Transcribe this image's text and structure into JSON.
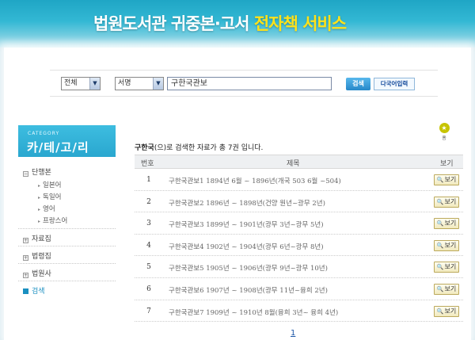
{
  "header": {
    "title_main": "법원도서관 귀중본·고서",
    "title_accent": "전자책 서비스"
  },
  "search": {
    "scope_value": "전체",
    "field_value": "서명",
    "query_value": "구한국관보",
    "search_button": "검색",
    "multi_lang_button": "다국어입력"
  },
  "sidebar": {
    "category_en": "CATEGORY",
    "category_ko": "카/테/고/리",
    "items": [
      {
        "label": "단행본",
        "expanded": true
      },
      {
        "label": "일본어"
      },
      {
        "label": "독일어"
      },
      {
        "label": "영어"
      },
      {
        "label": "프랑스어"
      },
      {
        "label": "자료집"
      },
      {
        "label": "법령집"
      },
      {
        "label": "법원사"
      },
      {
        "label": "검색",
        "active": true
      }
    ]
  },
  "home": {
    "label": "홈"
  },
  "results": {
    "keyword": "구한국",
    "summary_rest": "(으)로 검색한 자료가 총 7권 입니다."
  },
  "table": {
    "headers": {
      "num": "번호",
      "title": "제목",
      "view": "보기"
    },
    "view_label": "보기",
    "rows": [
      {
        "num": "1",
        "title": "구한국관보1 1894년 6월 ~ 1896년(개국 503 6월 ~504)"
      },
      {
        "num": "2",
        "title": "구한국관보2 1896년 ~ 1898년(건양 원년~광무 2년)"
      },
      {
        "num": "3",
        "title": "구한국관보3 1899년 ~ 1901년(광무 3년~광무 5년)"
      },
      {
        "num": "4",
        "title": "구한국관보4 1902년 ~ 1904년(광무 6년~광무 8년)"
      },
      {
        "num": "5",
        "title": "구한국관보5 1905년 ~ 1906년(광무 9년~광무 10년)"
      },
      {
        "num": "6",
        "title": "구한국관보6 1907년 ~ 1908년(광무 11년~융희 2년)"
      },
      {
        "num": "7",
        "title": "구한국관보7 1909년 ~ 1910년 8월(융희 3년~ 융희 4년)"
      }
    ]
  },
  "pager": {
    "current": "1"
  }
}
